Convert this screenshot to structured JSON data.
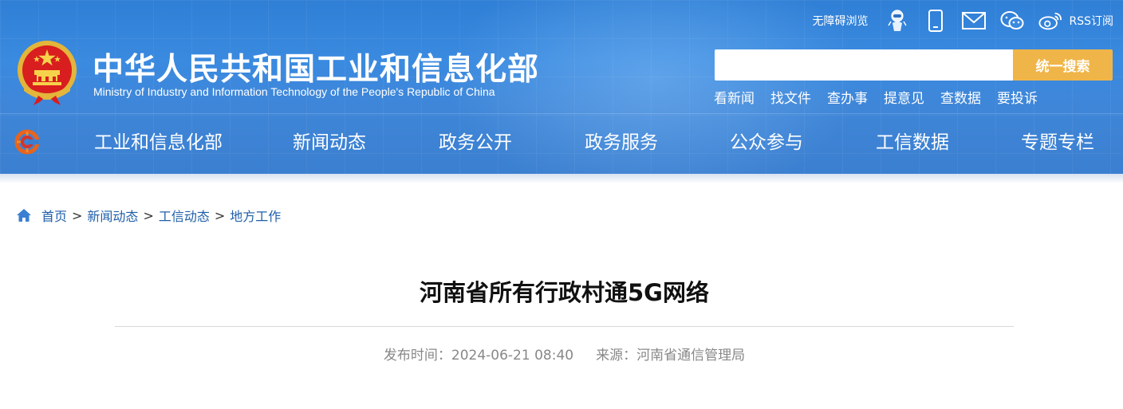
{
  "header": {
    "site_name_cn": "中华人民共和国工业和信息化部",
    "site_name_en": "Ministry of Industry and Information Technology of the People's Republic of China",
    "top_links": {
      "accessibility": "无障碍浏览",
      "rss": "RSS订阅"
    },
    "icons": [
      "robot-assistant-icon",
      "mobile-icon",
      "mail-icon",
      "wechat-icon",
      "weibo-icon"
    ],
    "search": {
      "placeholder": "",
      "button_label": "统一搜索"
    },
    "quick_links": [
      "看新闻",
      "找文件",
      "查办事",
      "提意见",
      "查数据",
      "要投诉"
    ]
  },
  "nav": {
    "items": [
      "工业和信息化部",
      "新闻动态",
      "政务公开",
      "政务服务",
      "公众参与",
      "工信数据",
      "专题专栏"
    ]
  },
  "breadcrumb": {
    "items": [
      "首页",
      "新闻动态",
      "工信动态",
      "地方工作"
    ],
    "separator": ">"
  },
  "article": {
    "title": "河南省所有行政村通5G网络",
    "publish_label": "发布时间：",
    "publish_time": "2024-06-21 08:40",
    "source_label": "来源：",
    "source": "河南省通信管理局"
  },
  "colors": {
    "header_blue": "#3a8ae0",
    "search_button": "#f0b548",
    "link_blue": "#1f5fa9",
    "meta_gray": "#888888"
  }
}
